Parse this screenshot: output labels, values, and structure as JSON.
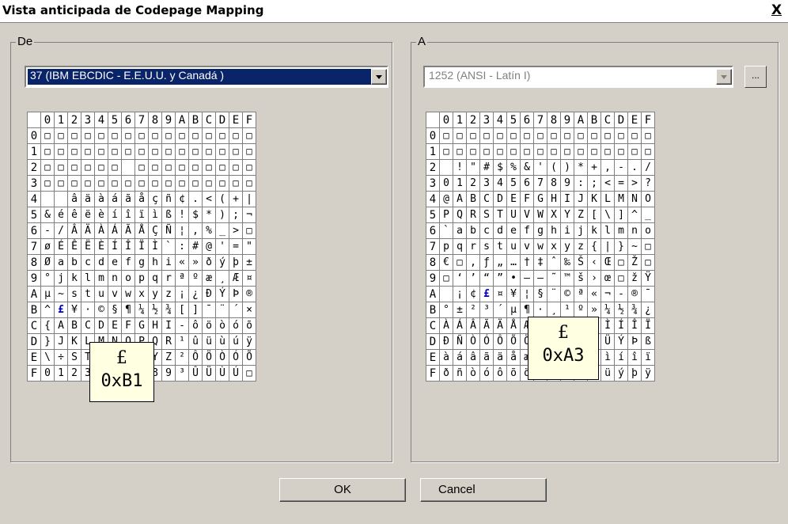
{
  "window": {
    "title": "Vista anticipada de Codepage Mapping",
    "close_label": "X"
  },
  "source": {
    "legend": "De",
    "selected": "37   (IBM EBCDIC - E.E.U.U. y Canadá )",
    "tooltip": {
      "symbol": "£",
      "code": "0xB1"
    },
    "selected_cell": "B1",
    "rows": [
      [
        "□",
        "□",
        "□",
        "□",
        "□",
        "□",
        "□",
        "□",
        "□",
        "□",
        "□",
        "□",
        "□",
        "□",
        "□",
        "□"
      ],
      [
        "□",
        "□",
        "□",
        "□",
        "□",
        "□",
        "□",
        "□",
        "□",
        "□",
        "□",
        "□",
        "□",
        "□",
        "□",
        "□"
      ],
      [
        "□",
        "□",
        "□",
        "□",
        "□",
        "□",
        "",
        "□",
        "□",
        "□",
        "□",
        "□",
        "□",
        "□",
        "□",
        "□"
      ],
      [
        "□",
        "□",
        "□",
        "□",
        "□",
        "□",
        "□",
        "□",
        "□",
        "□",
        "□",
        "□",
        "□",
        "□",
        "□",
        "□"
      ],
      [
        "",
        "",
        "â",
        "ä",
        "à",
        "á",
        "ã",
        "å",
        "ç",
        "ñ",
        "¢",
        ".",
        "<",
        "(",
        "+",
        "|"
      ],
      [
        "&",
        "é",
        "ê",
        "ë",
        "è",
        "í",
        "î",
        "ï",
        "ì",
        "ß",
        "!",
        "$",
        "*",
        ")",
        ";",
        "¬"
      ],
      [
        "-",
        "/",
        "Â",
        "Ä",
        "À",
        "Á",
        "Ã",
        "Å",
        "Ç",
        "Ñ",
        "¦",
        ",",
        "%",
        "_",
        ">",
        "□"
      ],
      [
        "ø",
        "É",
        "Ê",
        "Ë",
        "È",
        "Í",
        "Î",
        "Ï",
        "Ì",
        "`",
        ":",
        "#",
        "@",
        "'",
        "=",
        "\""
      ],
      [
        "Ø",
        "a",
        "b",
        "c",
        "d",
        "e",
        "f",
        "g",
        "h",
        "i",
        "«",
        "»",
        "ð",
        "ý",
        "þ",
        "±"
      ],
      [
        "°",
        "j",
        "k",
        "l",
        "m",
        "n",
        "o",
        "p",
        "q",
        "r",
        "ª",
        "º",
        "æ",
        "¸",
        "Æ",
        "¤"
      ],
      [
        "µ",
        "~",
        "s",
        "t",
        "u",
        "v",
        "w",
        "x",
        "y",
        "z",
        "¡",
        "¿",
        "Ð",
        "Ý",
        "Þ",
        "®"
      ],
      [
        "^",
        "£",
        "¥",
        "·",
        "©",
        "§",
        "¶",
        "¼",
        "½",
        "¾",
        "[",
        "]",
        "¯",
        "¨",
        "´",
        "×"
      ],
      [
        "{",
        "A",
        "B",
        "C",
        "D",
        "E",
        "F",
        "G",
        "H",
        "I",
        "-",
        "ô",
        "ö",
        "ò",
        "ó",
        "õ"
      ],
      [
        "}",
        "J",
        "K",
        "L",
        "M",
        "N",
        "O",
        "P",
        "Q",
        "R",
        "¹",
        "û",
        "ü",
        "ù",
        "ú",
        "ÿ"
      ],
      [
        "\\",
        "÷",
        "S",
        "T",
        "U",
        "V",
        "W",
        "X",
        "Y",
        "Z",
        "²",
        "Ô",
        "Ö",
        "Ò",
        "Ó",
        "Õ"
      ],
      [
        "0",
        "1",
        "2",
        "3",
        "4",
        "5",
        "6",
        "7",
        "8",
        "9",
        "³",
        "Û",
        "Ü",
        "Ù",
        "Ú",
        "□"
      ]
    ]
  },
  "target": {
    "legend": "A",
    "selected": "1252  (ANSI - Latín I)",
    "browse_label": "...",
    "tooltip": {
      "symbol": "£",
      "code": "0xA3"
    },
    "selected_cell": "A3",
    "rows": [
      [
        "□",
        "□",
        "□",
        "□",
        "□",
        "□",
        "□",
        "□",
        "□",
        "□",
        "□",
        "□",
        "□",
        "□",
        "□",
        "□"
      ],
      [
        "□",
        "□",
        "□",
        "□",
        "□",
        "□",
        "□",
        "□",
        "□",
        "□",
        "□",
        "□",
        "□",
        "□",
        "□",
        "□"
      ],
      [
        "",
        "!",
        "\"",
        "#",
        "$",
        "%",
        "&",
        "'",
        "(",
        ")",
        "*",
        "+",
        ",",
        "-",
        ".",
        "/"
      ],
      [
        "0",
        "1",
        "2",
        "3",
        "4",
        "5",
        "6",
        "7",
        "8",
        "9",
        ":",
        ";",
        "<",
        "=",
        ">",
        "?"
      ],
      [
        "@",
        "A",
        "B",
        "C",
        "D",
        "E",
        "F",
        "G",
        "H",
        "I",
        "J",
        "K",
        "L",
        "M",
        "N",
        "O"
      ],
      [
        "P",
        "Q",
        "R",
        "S",
        "T",
        "U",
        "V",
        "W",
        "X",
        "Y",
        "Z",
        "[",
        "\\",
        "]",
        "^",
        "_"
      ],
      [
        "`",
        "a",
        "b",
        "c",
        "d",
        "e",
        "f",
        "g",
        "h",
        "i",
        "j",
        "k",
        "l",
        "m",
        "n",
        "o"
      ],
      [
        "p",
        "q",
        "r",
        "s",
        "t",
        "u",
        "v",
        "w",
        "x",
        "y",
        "z",
        "{",
        "|",
        "}",
        "~",
        "□"
      ],
      [
        "€",
        "□",
        "‚",
        "ƒ",
        "„",
        "…",
        "†",
        "‡",
        "ˆ",
        "‰",
        "Š",
        "‹",
        "Œ",
        "□",
        "Ž",
        "□"
      ],
      [
        "□",
        "‘",
        "’",
        "“",
        "”",
        "•",
        "–",
        "—",
        "˜",
        "™",
        "š",
        "›",
        "œ",
        "□",
        "ž",
        "Ÿ"
      ],
      [
        "",
        "¡",
        "¢",
        "£",
        "¤",
        "¥",
        "¦",
        "§",
        "¨",
        "©",
        "ª",
        "«",
        "¬",
        "-",
        "®",
        "¯"
      ],
      [
        "°",
        "±",
        "²",
        "³",
        "´",
        "µ",
        "¶",
        "·",
        "¸",
        "¹",
        "º",
        "»",
        "¼",
        "½",
        "¾",
        "¿"
      ],
      [
        "À",
        "Á",
        "Â",
        "Ã",
        "Ä",
        "Å",
        "Æ",
        "Ç",
        "È",
        "É",
        "Ê",
        "Ë",
        "Ì",
        "Í",
        "Î",
        "Ï"
      ],
      [
        "Ð",
        "Ñ",
        "Ò",
        "Ó",
        "Ô",
        "Õ",
        "Ö",
        "×",
        "Ø",
        "Ù",
        "Ú",
        "Û",
        "Ü",
        "Ý",
        "Þ",
        "ß"
      ],
      [
        "à",
        "á",
        "â",
        "ã",
        "ä",
        "å",
        "æ",
        "ç",
        "è",
        "é",
        "ê",
        "ë",
        "ì",
        "í",
        "î",
        "ï"
      ],
      [
        "ð",
        "ñ",
        "ò",
        "ó",
        "ô",
        "õ",
        "ö",
        "÷",
        "ø",
        "ù",
        "ú",
        "û",
        "ü",
        "ý",
        "þ",
        "ÿ"
      ]
    ]
  },
  "hex_digits": [
    "0",
    "1",
    "2",
    "3",
    "4",
    "5",
    "6",
    "7",
    "8",
    "9",
    "A",
    "B",
    "C",
    "D",
    "E",
    "F"
  ],
  "buttons": {
    "ok": "OK",
    "cancel": "Cancel"
  }
}
